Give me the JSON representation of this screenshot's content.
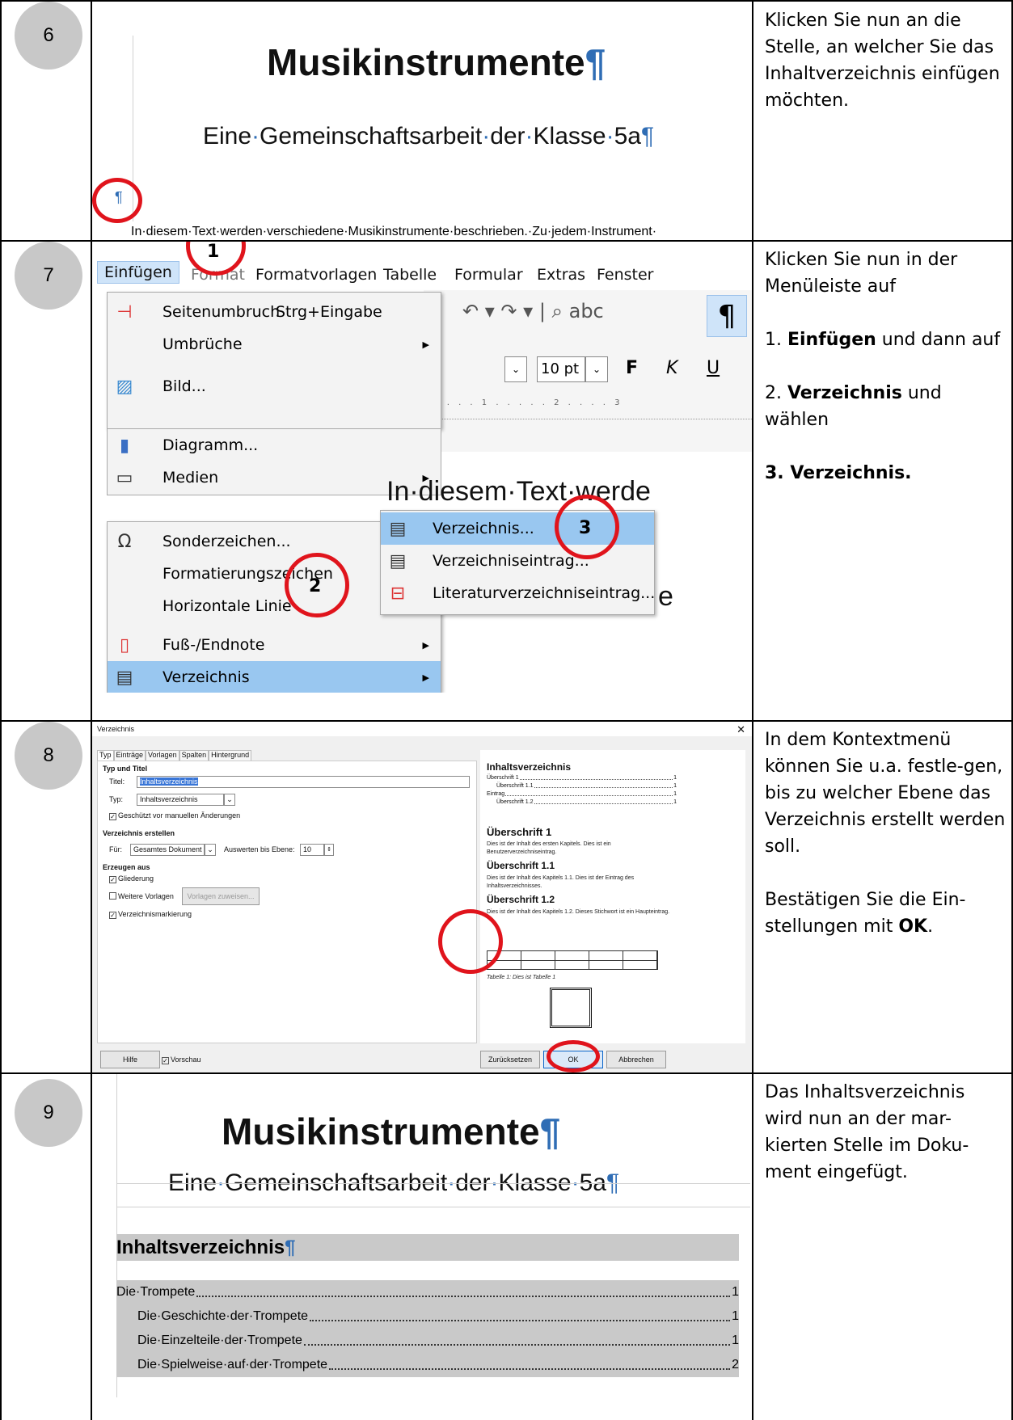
{
  "rows": {
    "r6": {
      "number": "6",
      "doc_title": "Musikinstrumente",
      "doc_subtitle_words": [
        "Eine",
        "Gemeinschaftsarbeit",
        "der",
        "Klasse",
        "5a"
      ],
      "doc_line": "In·diesem·Text·werden·verschiedene·Musikinstrumente·beschrieben.·Zu·jedem·Instrument·",
      "pilcrow": "¶",
      "instruction": "Klicken Sie nun an die Stelle, an welcher Sie das Inhaltverzeichnis einfügen möchten."
    },
    "r7": {
      "number": "7",
      "menubar": [
        "Einfügen",
        "Format",
        "Formatvorlagen",
        "Tabelle",
        "Formular",
        "Extras",
        "Fenster"
      ],
      "font_size": "10 pt",
      "format_buttons": [
        "F",
        "K",
        "U"
      ],
      "menu_items": [
        {
          "label": "Seitenumbruch",
          "shortcut": "Strg+Eingabe",
          "icon": "page-break-icon"
        },
        {
          "label": "Umbrüche",
          "icon": "none"
        },
        {
          "label": "Bild...",
          "icon": "image-icon"
        },
        {
          "label": "Diagramm...",
          "icon": "chart-icon"
        },
        {
          "label": "Medien",
          "icon": "media-icon"
        },
        {
          "label": "Sonderzeichen...",
          "icon": "omega-icon"
        },
        {
          "label": "Formatierungszeichen",
          "icon": "none"
        },
        {
          "label": "Horizontale Linie",
          "icon": "none"
        },
        {
          "label": "Fuß-/Endnote",
          "icon": "footnote-icon"
        },
        {
          "label": "Verzeichnis",
          "icon": "index-icon"
        }
      ],
      "submenu_items": [
        "Verzeichnis...",
        "Verzeichniseintrag...",
        "Literaturverzeichniseintrag..."
      ],
      "bg_text": "In·diesem·Text·werde",
      "markers": [
        "1",
        "2",
        "3"
      ],
      "instruction_intro": "Klicken Sie nun in der Menüleiste auf",
      "step1_bold": "Einfügen",
      "step1_rest": "und dann auf",
      "step2_bold": "Verzeichnis",
      "step2_rest": "und wählen",
      "step3": "3. Verzeichnis."
    },
    "r8": {
      "number": "8",
      "dialog_title": "Verzeichnis",
      "tabs": [
        "Typ",
        "Einträge",
        "Vorlagen",
        "Spalten",
        "Hintergrund"
      ],
      "sec_type": "Typ und Titel",
      "title_label": "Titel:",
      "title_value": "Inhaltsverzeichnis",
      "type_label": "Typ:",
      "type_value": "Inhaltsverzeichnis",
      "protected": "Geschützt vor manuellen Änderungen",
      "sec_create": "Verzeichnis erstellen",
      "for_label": "Für:",
      "for_value": "Gesamtes Dokument",
      "level_label": "Auswerten bis Ebene:",
      "level_value": "10",
      "sec_from": "Erzeugen aus",
      "opt1": "Gliederung",
      "opt2": "Weitere Vorlagen",
      "assign_btn": "Vorlagen zuweisen...",
      "opt3": "Verzeichnismarkierung",
      "help_btn": "Hilfe",
      "preview_chk": "Vorschau",
      "reset_btn": "Zurücksetzen",
      "ok_btn": "OK",
      "cancel_btn": "Abbrechen",
      "pv_title": "Inhaltsverzeichnis",
      "pv_toc": [
        {
          "t": "Überschrift 1",
          "p": "1"
        },
        {
          "t": "Überschrift 1.1",
          "p": "1"
        },
        {
          "t": "Eintrag",
          "p": "1"
        },
        {
          "t": "Überschrift 1.2",
          "p": "1"
        }
      ],
      "pv_h1": "Überschrift 1",
      "pv_p1": "Dies ist der Inhalt des ersten Kapitels. Dies ist ein Benutzerverzeichniseintrag.",
      "pv_h11": "Überschrift 1.1",
      "pv_p11": "Dies ist der Inhalt des Kapitels 1.1. Dies ist der Eintrag des Inhaltsverzeichnisses.",
      "pv_h12": "Überschrift 1.2",
      "pv_p12": "Dies ist der Inhalt des Kapitels 1.2. Dieses Stichwort ist ein Haupteintrag.",
      "pv_caption": "Tabelle 1: Dies ist Tabelle 1",
      "instruction_a": "In dem Kontextmenü können Sie u.a. festle-gen, bis zu welcher Ebene das Verzeichnis erstellt werden soll.",
      "instruction_b": "Bestätigen Sie die Ein-stellungen mit",
      "instruction_b_bold": "OK",
      "instruction_b_end": "."
    },
    "r9": {
      "number": "9",
      "doc_title": "Musikinstrumente",
      "doc_subtitle_words": [
        "Eine",
        "Gemeinschaftsarbeit",
        "der",
        "Klasse",
        "5a"
      ],
      "toc_heading": "Inhaltsverzeichnis",
      "toc": [
        {
          "t": "Die·Trompete",
          "p": "1"
        },
        {
          "t": "Die·Geschichte·der·Trompete",
          "p": "1"
        },
        {
          "t": "Die·Einzelteile·der·Trompete",
          "p": "1"
        },
        {
          "t": "Die·Spielweise·auf·der·Trompete",
          "p": "2"
        }
      ],
      "instruction": "Das Inhaltsverzeichnis wird nun an der mar-kierten Stelle im Doku-ment eingefügt."
    }
  },
  "colors": {
    "accent_red": "#e0141c",
    "pilcrow_blue": "#2f6db5",
    "menu_select": "#99c7f0",
    "toc_shade": "#c9c9c9"
  }
}
